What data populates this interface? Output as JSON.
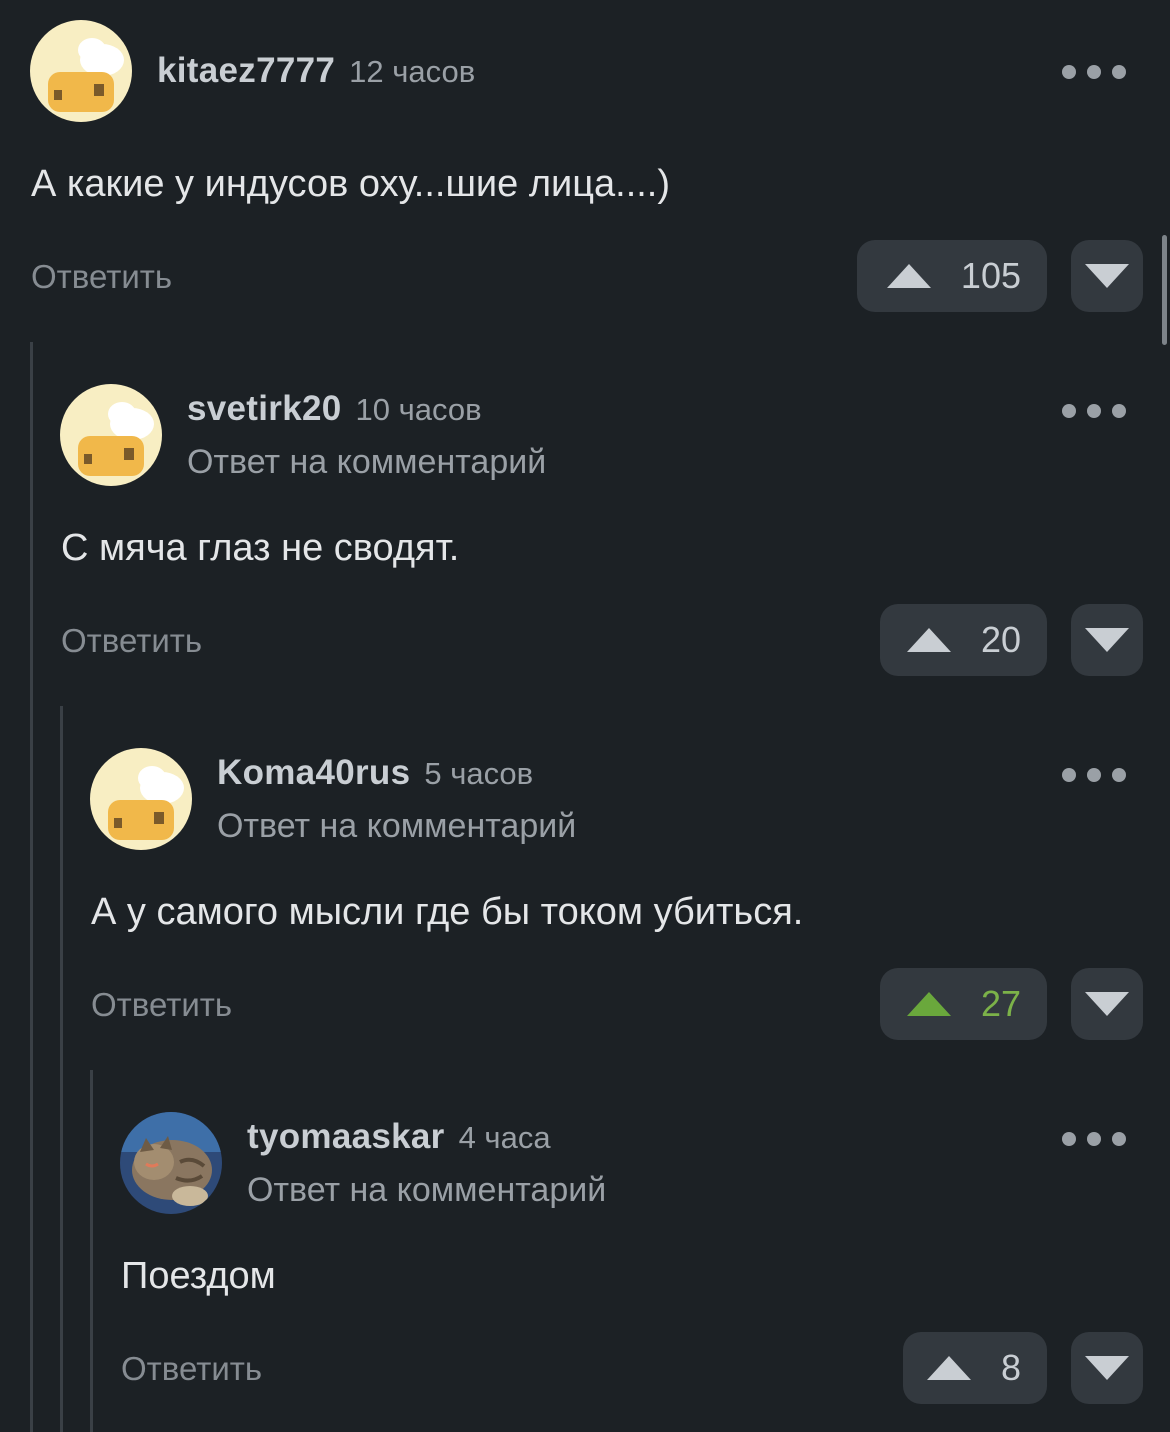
{
  "reply_label": "Ответить",
  "reply_note": "Ответ на комментарий",
  "colors": {
    "background": "#1c2125",
    "button": "#33393f",
    "upvoted": "#7cb249"
  },
  "comments": [
    {
      "username": "kitaez7777",
      "time": "12 часов",
      "text": "А какие у индусов оху...шие лица....)",
      "rating": "105",
      "avatar": "default-chef-avatar"
    },
    {
      "username": "svetirk20",
      "time": "10 часов",
      "text": "С мяча глаз не сводят.",
      "rating": "20",
      "avatar": "default-chef-avatar"
    },
    {
      "username": "Koma40rus",
      "time": "5 часов",
      "text": "А у самого мысли где бы током убиться.",
      "rating": "27",
      "avatar": "default-chef-avatar",
      "upvoted": true
    },
    {
      "username": "tyomaaskar",
      "time": "4 часа",
      "text": "Поездом",
      "rating": "8",
      "avatar": "cat-photo-avatar"
    }
  ]
}
